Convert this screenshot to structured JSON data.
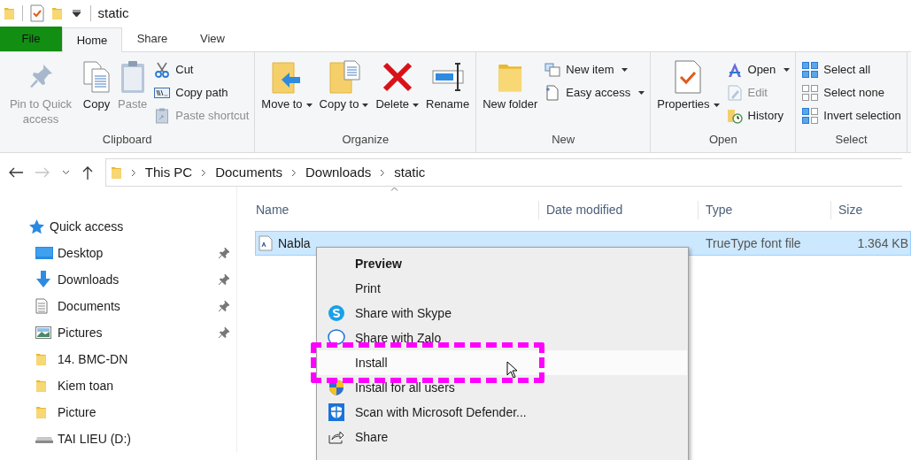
{
  "window": {
    "title": "static"
  },
  "file_tab": {
    "label": "File"
  },
  "tabs": [
    {
      "label": "Home",
      "selected": true
    },
    {
      "label": "Share",
      "selected": false
    },
    {
      "label": "View",
      "selected": false
    }
  ],
  "ribbon": {
    "groups": [
      {
        "label": "Clipboard",
        "buttons": [
          {
            "label": "Pin to Quick access",
            "kind": "large",
            "disabled": true,
            "dropdown": false
          },
          {
            "label": "Copy",
            "kind": "large",
            "disabled": false,
            "dropdown": false
          },
          {
            "label": "Paste",
            "kind": "large",
            "disabled": true,
            "dropdown": false
          },
          {
            "label": "Cut",
            "kind": "small",
            "disabled": false,
            "dropdown": false
          },
          {
            "label": "Copy path",
            "kind": "small",
            "disabled": false,
            "dropdown": false
          },
          {
            "label": "Paste shortcut",
            "kind": "small",
            "disabled": true,
            "dropdown": false
          }
        ]
      },
      {
        "label": "Organize",
        "buttons": [
          {
            "label": "Move to",
            "kind": "large",
            "disabled": false,
            "dropdown": true
          },
          {
            "label": "Copy to",
            "kind": "large",
            "disabled": false,
            "dropdown": true
          },
          {
            "label": "Delete",
            "kind": "large",
            "disabled": false,
            "dropdown": true
          },
          {
            "label": "Rename",
            "kind": "large",
            "disabled": false,
            "dropdown": false
          }
        ]
      },
      {
        "label": "New",
        "buttons": [
          {
            "label": "New folder",
            "kind": "large",
            "disabled": false,
            "dropdown": false
          },
          {
            "label": "New item",
            "kind": "small",
            "disabled": false,
            "dropdown": true
          },
          {
            "label": "Easy access",
            "kind": "small",
            "disabled": false,
            "dropdown": true
          }
        ]
      },
      {
        "label": "Open",
        "buttons": [
          {
            "label": "Properties",
            "kind": "large",
            "disabled": false,
            "dropdown": true
          },
          {
            "label": "Open",
            "kind": "small",
            "disabled": false,
            "dropdown": true
          },
          {
            "label": "Edit",
            "kind": "small",
            "disabled": true,
            "dropdown": false
          },
          {
            "label": "History",
            "kind": "small",
            "disabled": false,
            "dropdown": false
          }
        ]
      },
      {
        "label": "Select",
        "buttons": [
          {
            "label": "Select all",
            "kind": "small",
            "disabled": false,
            "dropdown": false
          },
          {
            "label": "Select none",
            "kind": "small",
            "disabled": false,
            "dropdown": false
          },
          {
            "label": "Invert selection",
            "kind": "small",
            "disabled": false,
            "dropdown": false
          }
        ]
      }
    ]
  },
  "address_bar": {
    "forward_disabled": true,
    "path": [
      "This PC",
      "Documents",
      "Downloads",
      "static"
    ]
  },
  "navigation": {
    "header": "Quick access",
    "items": [
      {
        "label": "Desktop",
        "pinned": true
      },
      {
        "label": "Downloads",
        "pinned": true
      },
      {
        "label": "Documents",
        "pinned": true
      },
      {
        "label": "Pictures",
        "pinned": true
      },
      {
        "label": "14. BMC-DN",
        "pinned": false
      },
      {
        "label": "Kiem toan",
        "pinned": false
      },
      {
        "label": "Picture",
        "pinned": false
      },
      {
        "label": "TAI LIEU (D:)",
        "pinned": false
      }
    ]
  },
  "file_list": {
    "columns": [
      "Name",
      "Date modified",
      "Type",
      "Size"
    ],
    "rows": [
      {
        "name": "Nabla",
        "type": "TrueType font file",
        "size": "1.364 KB",
        "selected": true
      }
    ]
  },
  "context_menu": {
    "items": [
      {
        "label": "Preview",
        "default": true,
        "selected": false
      },
      {
        "label": "Print",
        "default": false,
        "selected": false
      },
      {
        "label": "Share with Skype",
        "default": false,
        "selected": false
      },
      {
        "label": "Share with Zalo",
        "default": false,
        "selected": false
      },
      {
        "label": "Install",
        "default": false,
        "selected": true
      },
      {
        "label": "Install for all users",
        "default": false,
        "selected": false
      },
      {
        "label": "Scan with Microsoft Defender...",
        "default": false,
        "selected": false
      },
      {
        "label": "Share",
        "default": false,
        "selected": false
      }
    ]
  }
}
